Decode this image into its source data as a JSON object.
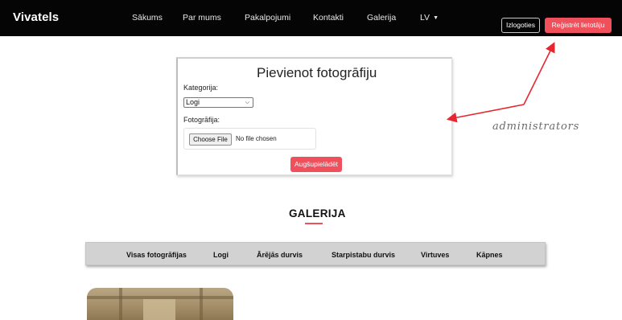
{
  "navbar": {
    "brand": "Vivatels",
    "links": [
      {
        "label": "Sākums"
      },
      {
        "label": "Par mums"
      },
      {
        "label": "Pakalpojumi"
      },
      {
        "label": "Kontakti"
      },
      {
        "label": "Galerija"
      },
      {
        "label": "LV"
      }
    ],
    "logout_label": "Izlogoties",
    "register_label": "Reģistrēt lietotāju"
  },
  "upload_form": {
    "title": "Pievienot fotogrāfiju",
    "category_label": "Kategorija:",
    "category_selected": "Logi",
    "photo_label": "Fotogrāfija:",
    "choose_file_label": "Choose File",
    "no_file_text": "No file chosen",
    "submit_label": "Augšupielādēt"
  },
  "annotation": {
    "text": "administrators",
    "color": "#e8262f"
  },
  "gallery": {
    "title": "GALERIJA",
    "filters": [
      {
        "label": "Visas fotogrāfijas"
      },
      {
        "label": "Logi"
      },
      {
        "label": "Ārējās durvis"
      },
      {
        "label": "Starpistabu durvis"
      },
      {
        "label": "Virtuves"
      },
      {
        "label": "Kāpnes"
      }
    ]
  },
  "colors": {
    "accent": "#f0505c",
    "navbar_bg": "#050505"
  },
  "icons": {
    "dropdown": "chevron-down-icon",
    "lang_caret": "caret-down-icon"
  }
}
